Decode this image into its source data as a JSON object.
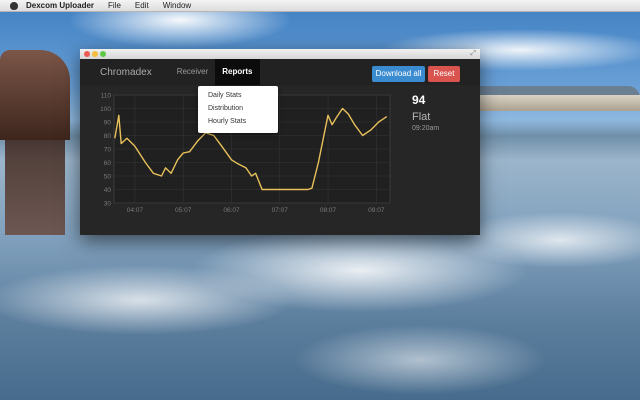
{
  "menubar": {
    "app_name": "Dexcom Uploader",
    "items": [
      "File",
      "Edit",
      "Window"
    ]
  },
  "nav": {
    "brand": "Chromadex",
    "receiver": "Receiver",
    "reports": "Reports",
    "download_all": "Download all",
    "reset": "Reset"
  },
  "reports_menu": {
    "items": [
      "Daily Stats",
      "Distribution",
      "Hourly Stats"
    ]
  },
  "reading": {
    "value": "94",
    "trend": "Flat",
    "time": "09:20am"
  },
  "colors": {
    "accent_blue": "#3a8bd0",
    "reset_red": "#d9534f",
    "line": "#e8c15a"
  },
  "chart_data": {
    "type": "line",
    "title": "",
    "xlabel": "",
    "ylabel": "",
    "y_ticks": [
      "30",
      "40",
      "50",
      "60",
      "70",
      "80",
      "90",
      "100",
      "110"
    ],
    "ylim": [
      30,
      110
    ],
    "x_ticks": [
      "04:07",
      "05:07",
      "06:07",
      "07:07",
      "08:07",
      "09:07"
    ],
    "grid": true,
    "series": [
      {
        "x": [
          "03:42",
          "03:45",
          "03:47",
          "03:50",
          "03:57",
          "04:07",
          "04:20",
          "04:30",
          "04:40",
          "04:45",
          "04:52",
          "05:00",
          "05:07",
          "05:15",
          "05:25",
          "05:35",
          "05:45",
          "05:55",
          "06:07",
          "06:15",
          "06:25",
          "06:32",
          "06:37",
          "06:45",
          "07:07",
          "07:30",
          "07:42",
          "07:47",
          "07:55",
          "08:07",
          "08:12",
          "08:17",
          "08:25",
          "08:32",
          "08:40",
          "08:50",
          "09:00",
          "09:10",
          "09:20"
        ],
        "values": [
          78,
          88,
          95,
          74,
          78,
          72,
          60,
          52,
          50,
          56,
          52,
          62,
          67,
          68,
          76,
          82,
          80,
          72,
          62,
          59,
          56,
          50,
          52,
          40,
          40,
          40,
          40,
          41,
          60,
          95,
          88,
          93,
          100,
          96,
          88,
          80,
          84,
          90,
          94
        ]
      }
    ]
  }
}
